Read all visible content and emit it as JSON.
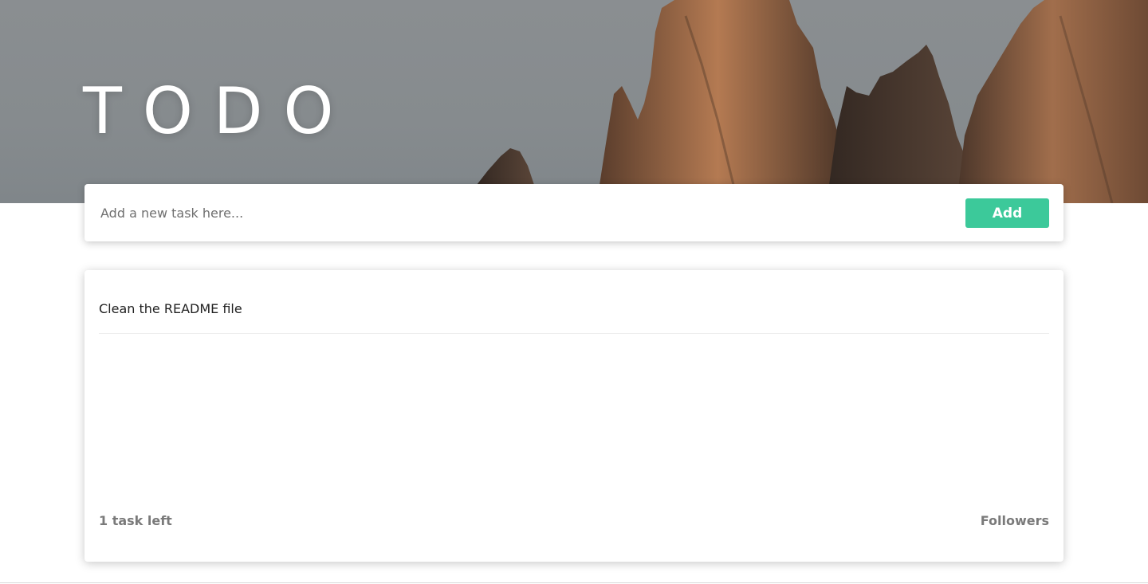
{
  "header": {
    "title": "TODO"
  },
  "add_form": {
    "placeholder": "Add a new task here...",
    "add_label": "Add"
  },
  "tasks": [
    {
      "text": "Clean the README file"
    }
  ],
  "footer": {
    "count_text": "1 task left",
    "right_link": "Followers"
  },
  "colors": {
    "accent": "#3cc99a",
    "hero_sky": "#888c8f",
    "rock": "#9a6a48"
  }
}
